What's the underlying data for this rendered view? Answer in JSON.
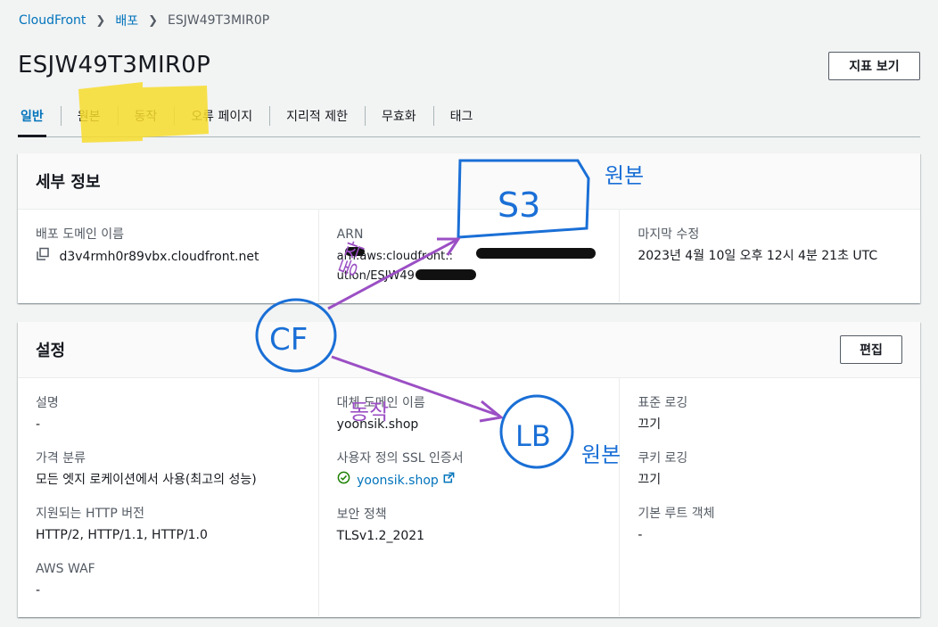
{
  "breadcrumb": {
    "root": "CloudFront",
    "section": "배포",
    "current": "ESJW49T3MIR0P"
  },
  "page": {
    "title": "ESJW49T3MIR0P",
    "view_metrics_label": "지표 보기"
  },
  "tabs": [
    {
      "label": "일반",
      "active": true
    },
    {
      "label": "원본"
    },
    {
      "label": "동작"
    },
    {
      "label": "오류 페이지"
    },
    {
      "label": "지리적 제한"
    },
    {
      "label": "무효화"
    },
    {
      "label": "태그"
    }
  ],
  "details": {
    "title": "세부 정보",
    "domain_label": "배포 도메인 이름",
    "domain_value": "d3v4rmh0r89vbx.cloudfront.net",
    "arn_label": "ARN",
    "arn_value": "arn:aws:cloudfront::",
    "arn_value_2": "ution/ESJW49",
    "modified_label": "마지막 수정",
    "modified_value": "2023년 4월 10일 오후 12시 4분 21초 UTC"
  },
  "settings": {
    "title": "설정",
    "edit_label": "편집",
    "description_label": "설명",
    "description_value": "-",
    "price_class_label": "가격 분류",
    "price_class_value": "모든 엣지 로케이션에서 사용(최고의 성능)",
    "http_label": "지원되는 HTTP 버전",
    "http_value": "HTTP/2, HTTP/1.1, HTTP/1.0",
    "waf_label": "AWS WAF",
    "waf_value": "-",
    "cname_label": "대체 도메인 이름",
    "cname_value": "yoonsik.shop",
    "ssl_label": "사용자 정의 SSL 인증서",
    "ssl_value": "yoonsik.shop",
    "security_label": "보안 정책",
    "security_value": "TLSv1.2_2021",
    "std_logging_label": "표준 로깅",
    "std_logging_value": "끄기",
    "cookie_logging_label": "쿠키 로깅",
    "cookie_logging_value": "끄기",
    "root_object_label": "기본 루트 객체",
    "root_object_value": "-"
  },
  "annotations": {
    "s3": "S3",
    "origin_1": "원본",
    "behavior_1": "동작",
    "cf": "CF",
    "behavior_2": "동작",
    "lb": "LB",
    "origin_2": "원본",
    "pen_blue": "#1a6fd6",
    "pen_purple": "#9b4fc4",
    "highlight_yellow": "#f7dc2b",
    "redaction_black": "#111111"
  },
  "colors": {
    "link": "#0073bb",
    "success": "#1d8102",
    "border": "#aab7b8"
  }
}
